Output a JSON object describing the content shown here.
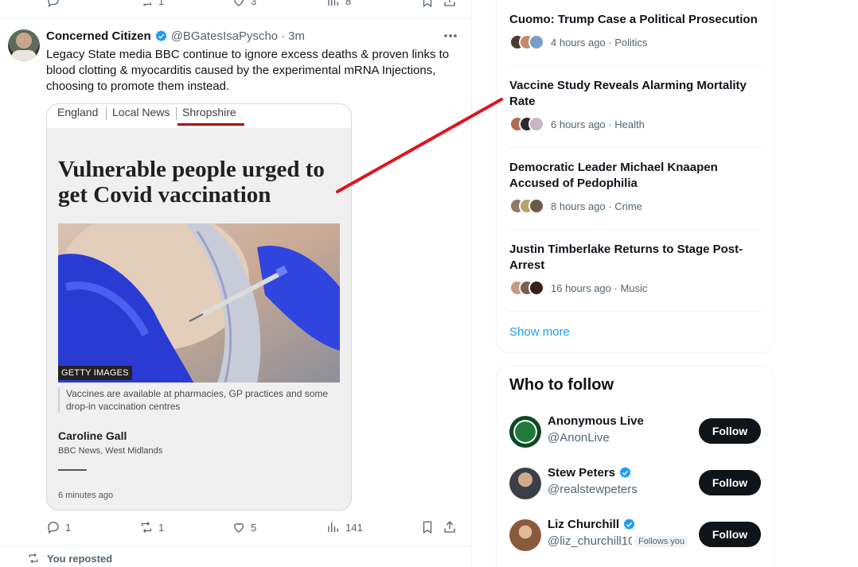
{
  "prev_tweet": {
    "reply_count": "",
    "retweet_count": "1",
    "like_count": "3",
    "view_count": "8"
  },
  "tweet": {
    "author_name": "Concerned Citizen",
    "handle": "@BGatesIsaPyscho",
    "separator": "·",
    "time": "3m",
    "text": "Legacy State media BBC continue to ignore excess deaths & proven links to blood clotting & myocarditis caused by the experimental mRNA Injections, choosing to promote them instead.",
    "media": {
      "breadcrumbs": [
        "England",
        "Local News",
        "Shropshire"
      ],
      "headline": "Vulnerable people urged to get Covid vaccination",
      "photo_credit": "GETTY IMAGES",
      "caption": "Vaccines are available at pharmacies, GP practices and some drop-in vaccination centres",
      "author": "Caroline Gall",
      "author_role": "BBC News, West Midlands",
      "published": "6 minutes ago"
    },
    "reply_count": "1",
    "retweet_count": "1",
    "like_count": "5",
    "view_count": "141"
  },
  "next_context": "You reposted",
  "trends": {
    "items": [
      {
        "title": "Cuomo: Trump Case a Political Prosecution",
        "meta": "4 hours ago · Politics"
      },
      {
        "title": "Vaccine Study Reveals Alarming Mortality Rate",
        "meta": "6 hours ago · Health"
      },
      {
        "title": "Democratic Leader Michael Knaapen Accused of Pedophilia",
        "meta": "8 hours ago · Crime"
      },
      {
        "title": "Justin Timberlake Returns to Stage Post-Arrest",
        "meta": "16 hours ago · Music"
      }
    ],
    "show_more": "Show more"
  },
  "who_to_follow": {
    "heading": "Who to follow",
    "accounts": [
      {
        "name": "Anonymous Live",
        "handle": "@AnonLive",
        "button": "Follow"
      },
      {
        "name": "Stew Peters",
        "handle": "@realstewpeters",
        "button": "Follow"
      },
      {
        "name": "Liz Churchill",
        "handle": "@liz_churchill10",
        "follows_you": "Follows you",
        "button": "Follow"
      }
    ]
  },
  "colors": {
    "accent": "#1d9bf0",
    "verified": "#1d9bf0",
    "annotation": "#e0141e",
    "bbc_red": "#b80000"
  },
  "icons": [
    "reply-icon",
    "retweet-icon",
    "like-icon",
    "views-icon",
    "bookmark-icon",
    "share-icon",
    "more-icon",
    "verified-icon"
  ]
}
